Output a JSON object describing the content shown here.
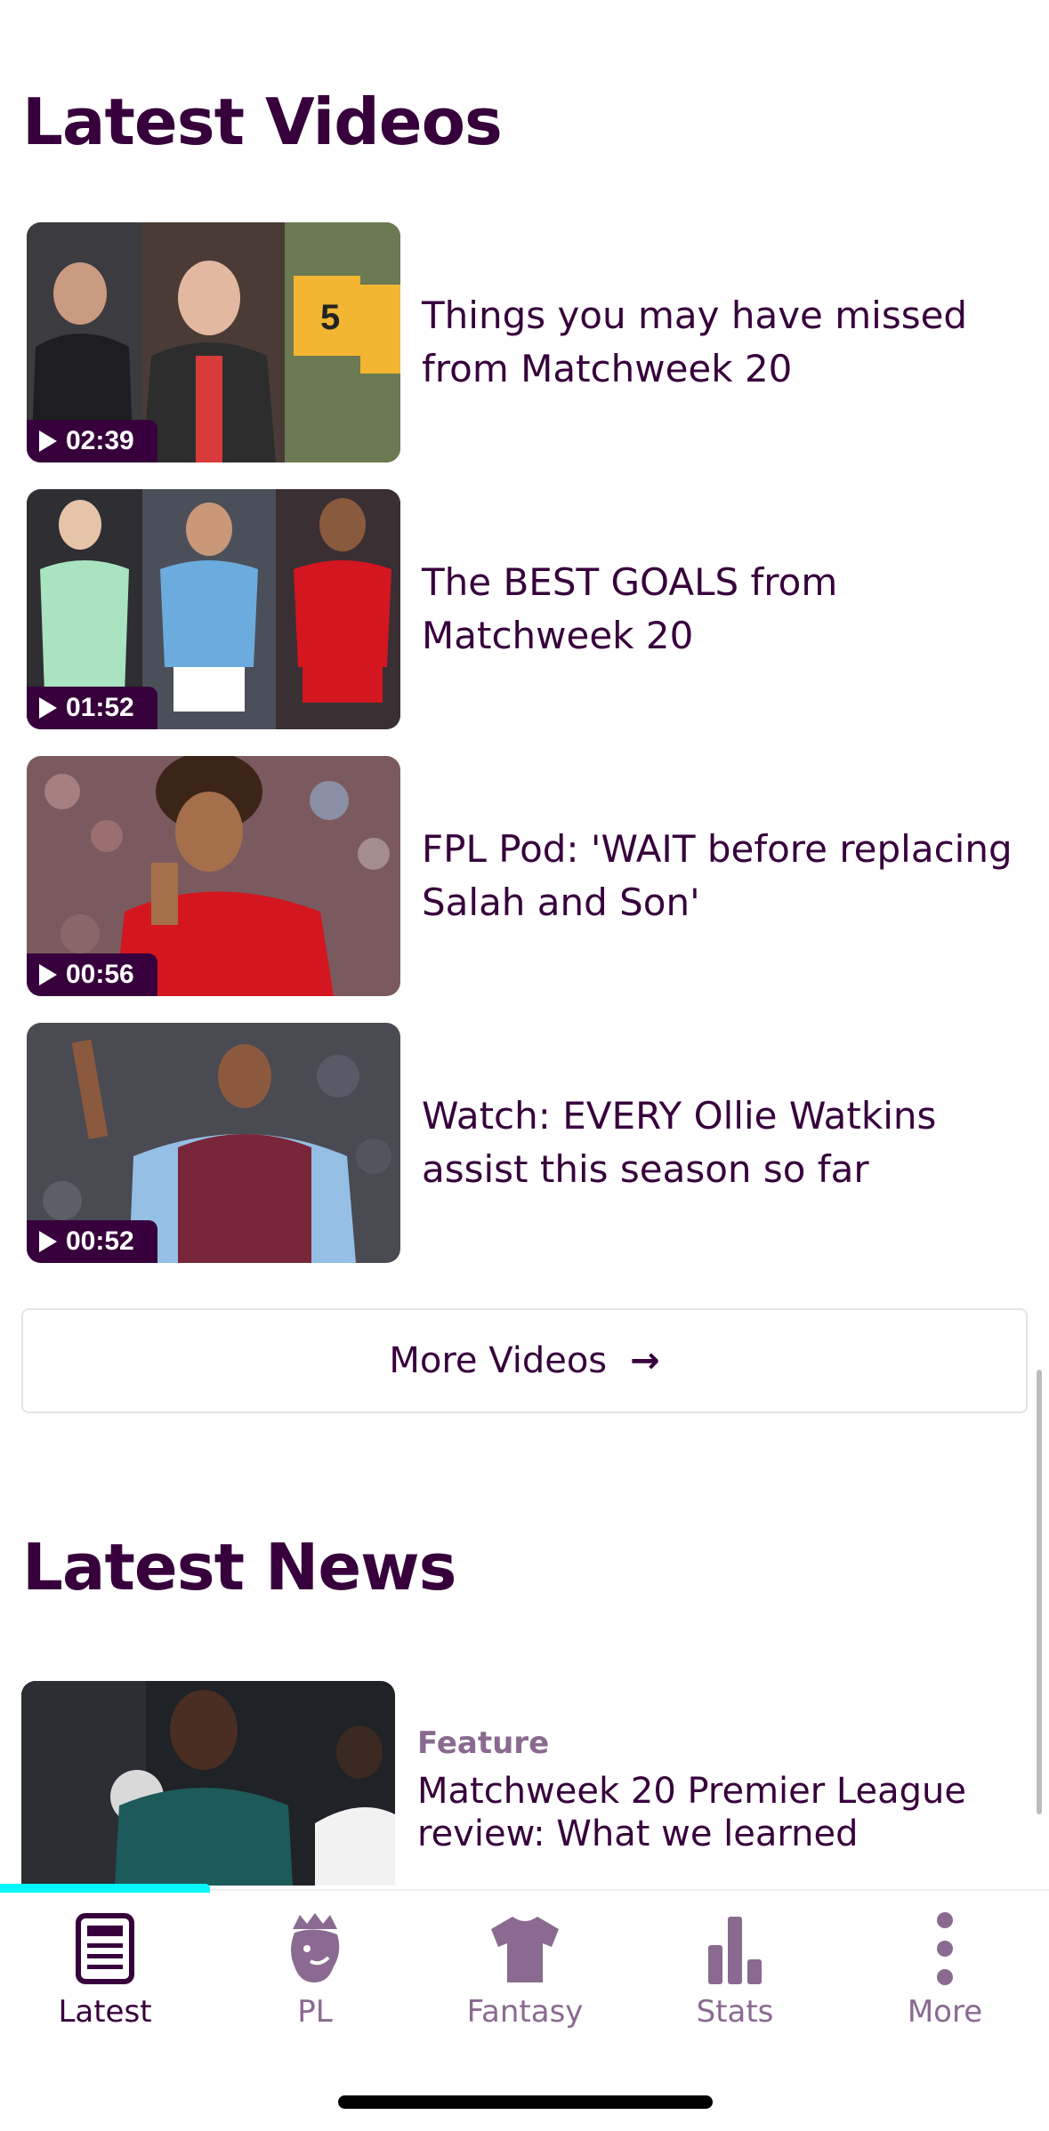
{
  "videos_section": {
    "title": "Latest Videos",
    "items": [
      {
        "duration": "02:39",
        "title": "Things you may have missed from Matchweek 20"
      },
      {
        "duration": "01:52",
        "title": "The BEST GOALS from Matchweek 20"
      },
      {
        "duration": "00:56",
        "title": "FPL Pod: 'WAIT before replacing Salah and Son'"
      },
      {
        "duration": "00:52",
        "title": "Watch: EVERY Ollie Watkins assist this season so far"
      }
    ],
    "more_label": "More Videos",
    "more_arrow": "→"
  },
  "news_section": {
    "title": "Latest News",
    "items": [
      {
        "tag": "Feature",
        "title": "Matchweek 20 Premier League review: What we learned"
      }
    ]
  },
  "tabbar": {
    "tabs": [
      {
        "label": "Latest",
        "icon": "news-icon",
        "active": true
      },
      {
        "label": "PL",
        "icon": "premier-league-lion-icon",
        "active": false
      },
      {
        "label": "Fantasy",
        "icon": "shirt-icon",
        "active": false
      },
      {
        "label": "Stats",
        "icon": "bar-chart-icon",
        "active": false
      },
      {
        "label": "More",
        "icon": "more-vertical-icon",
        "active": false
      }
    ]
  },
  "colors": {
    "brand_purple": "#37003c",
    "muted_purple": "#8a6a90",
    "accent_cyan": "#04f5ff"
  }
}
